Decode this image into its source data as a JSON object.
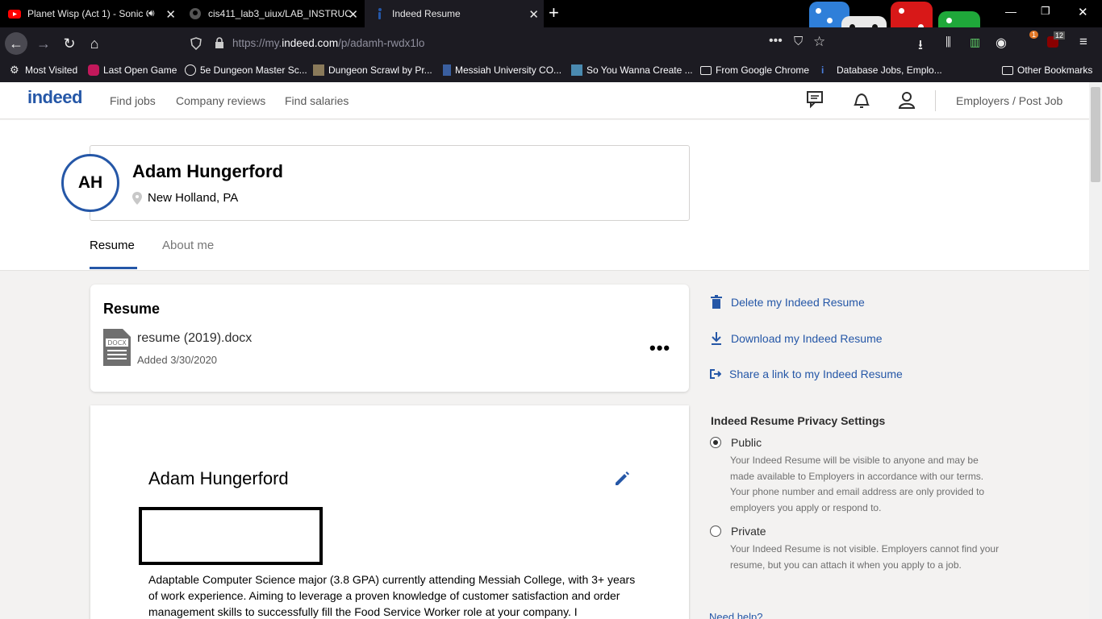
{
  "browser": {
    "tabs": [
      {
        "title": "Planet Wisp (Act 1) - Sonic C",
        "favicon": "youtube-icon"
      },
      {
        "title": "cis411_lab3_uiux/LAB_INSTRUC",
        "favicon": "github-icon"
      },
      {
        "title": "Indeed Resume",
        "favicon": "indeed-icon"
      }
    ],
    "url_prefix": "https://my.",
    "url_domain": "indeed.com",
    "url_path": "/p/adamh-rwdx1lo",
    "badges": {
      "extension_count": "1",
      "ublock_count": "12"
    },
    "bookmarks": [
      {
        "label": "Most Visited",
        "icon": "gear-icon"
      },
      {
        "label": "Last Open Game",
        "icon": "game-icon"
      },
      {
        "label": "5e Dungeon Master Sc...",
        "icon": "globe-icon"
      },
      {
        "label": "Dungeon Scrawl by Pr...",
        "icon": "map-icon"
      },
      {
        "label": "Messiah University CO...",
        "icon": "tower-icon"
      },
      {
        "label": "So You Wanna Create ...",
        "icon": "image-icon"
      },
      {
        "label": "From Google Chrome",
        "icon": "folder-icon"
      },
      {
        "label": "Database Jobs, Emplo...",
        "icon": "indeed-icon"
      },
      {
        "label": "Other Bookmarks",
        "icon": "folder-icon"
      }
    ]
  },
  "site": {
    "logo": "indeed",
    "nav": [
      "Find jobs",
      "Company reviews",
      "Find salaries"
    ],
    "employers_link": "Employers / Post Job",
    "brand_color": "#2557a7"
  },
  "profile": {
    "initials": "AH",
    "name": "Adam Hungerford",
    "location": "New Holland, PA",
    "tabs": [
      "Resume",
      "About me"
    ]
  },
  "resume_card": {
    "title": "Resume",
    "file_badge": "DOCX",
    "file_name": "resume (2019).docx",
    "added": "Added 3/30/2020",
    "menu": "•••"
  },
  "resume_doc": {
    "name": "Adam Hungerford",
    "summary": "Adaptable Computer Science major (3.8 GPA) currently attending Messiah College, with 3+ years of work experience. Aiming to leverage a proven knowledge of customer satisfaction and order management skills to successfully fill the Food Service Worker role at your company. I"
  },
  "sidebar": {
    "links": [
      "Delete my Indeed Resume",
      "Download my Indeed Resume",
      "Share a link to my Indeed Resume"
    ],
    "privacy_title": "Indeed Resume Privacy Settings",
    "options": [
      {
        "label": "Public",
        "checked": true,
        "desc": "Your Indeed Resume will be visible to anyone and may be made available to Employers in accordance with our terms. Your phone number and email address are only provided to employers you apply or respond to."
      },
      {
        "label": "Private",
        "checked": false,
        "desc": "Your Indeed Resume is not visible. Employers cannot find your resume, but you can attach it when you apply to a job."
      }
    ],
    "help": "Need help?"
  }
}
